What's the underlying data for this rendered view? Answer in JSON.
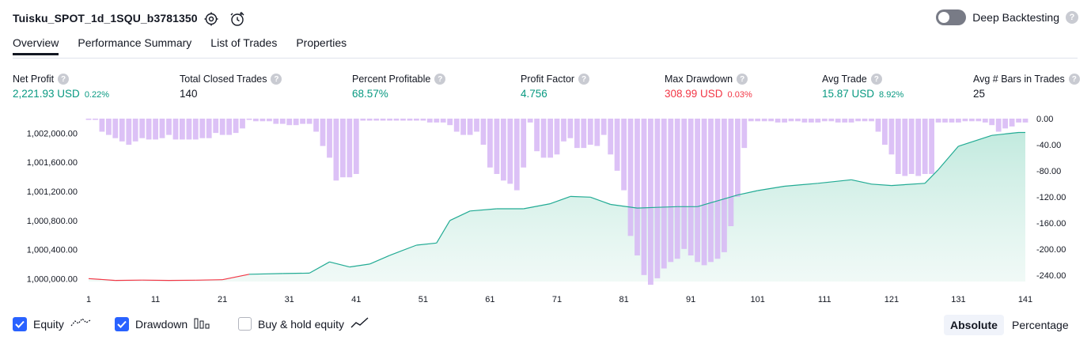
{
  "header": {
    "title": "Tuisku_SPOT_1d_1SQU_b3781350",
    "deep_backtesting_label": "Deep Backtesting",
    "help_glyph": "?"
  },
  "tabs": [
    {
      "label": "Overview"
    },
    {
      "label": "Performance Summary"
    },
    {
      "label": "List of Trades"
    },
    {
      "label": "Properties"
    }
  ],
  "metrics": {
    "net_profit": {
      "label": "Net Profit",
      "value": "2,221.93 USD",
      "pct": "0.22%"
    },
    "total_closed_trades": {
      "label": "Total Closed Trades",
      "value": "140"
    },
    "percent_profitable": {
      "label": "Percent Profitable",
      "value": "68.57%"
    },
    "profit_factor": {
      "label": "Profit Factor",
      "value": "4.756"
    },
    "max_drawdown": {
      "label": "Max Drawdown",
      "value": "308.99 USD",
      "pct": "0.03%"
    },
    "avg_trade": {
      "label": "Avg Trade",
      "value": "15.87 USD",
      "pct": "8.92%"
    },
    "avg_bars": {
      "label": "Avg # Bars in Trades",
      "value": "25"
    }
  },
  "legend": {
    "equity": "Equity",
    "drawdown": "Drawdown",
    "buy_hold": "Buy & hold equity",
    "absolute": "Absolute",
    "percentage": "Percentage"
  },
  "colors": {
    "green": "#089981",
    "red": "#f23645",
    "equity_line": "#22ab94",
    "equity_fill": "#cdeee6",
    "loss_line": "#f23645",
    "drawdown_bar": "#d6b6f5",
    "accent": "#2962ff"
  },
  "chart_data": {
    "type": "area",
    "x_ticks": [
      "1",
      "11",
      "21",
      "31",
      "41",
      "51",
      "61",
      "71",
      "81",
      "91",
      "101",
      "111",
      "121",
      "131",
      "141"
    ],
    "y_left_ticks": [
      "1,000,000.00",
      "1,000,400.00",
      "1,000,800.00",
      "1,001,200.00",
      "1,001,600.00",
      "1,002,000.00"
    ],
    "y_right_ticks": [
      "0.00",
      "-40.00",
      "-80.00",
      "-120.00",
      "-160.00",
      "-200.00",
      "-240.00"
    ],
    "x_range": [
      1,
      141
    ],
    "y_left_range": [
      999960,
      1002200
    ],
    "y_right_range": [
      -250,
      0
    ],
    "series": [
      {
        "name": "Equity",
        "type": "line",
        "x": [
          1,
          5,
          9,
          13,
          17,
          21,
          25,
          30,
          34,
          37,
          40,
          43,
          46,
          50,
          53,
          55,
          58,
          62,
          66,
          70,
          73,
          76,
          79,
          83,
          86,
          89,
          92,
          95,
          98,
          101,
          105,
          110,
          115,
          118,
          121,
          126,
          128,
          131,
          136,
          140,
          141
        ],
        "y": [
          1000000,
          999975,
          999980,
          999975,
          999978,
          999985,
          1000060,
          1000070,
          1000075,
          1000230,
          1000160,
          1000200,
          1000320,
          1000460,
          1000490,
          1000800,
          1000930,
          1000960,
          1000960,
          1001030,
          1001130,
          1001120,
          1001020,
          1000970,
          1000980,
          1000990,
          1000990,
          1001070,
          1001150,
          1001210,
          1001270,
          1001310,
          1001360,
          1001300,
          1001280,
          1001310,
          1001500,
          1001820,
          1001970,
          1002010,
          1002010
        ]
      },
      {
        "name": "Drawdown",
        "type": "bar",
        "x": [
          1,
          2,
          3,
          4,
          5,
          6,
          7,
          8,
          9,
          10,
          11,
          12,
          13,
          14,
          15,
          16,
          17,
          18,
          19,
          20,
          21,
          22,
          23,
          24,
          25,
          26,
          27,
          28,
          29,
          30,
          31,
          32,
          33,
          34,
          35,
          36,
          37,
          38,
          39,
          40,
          41,
          42,
          43,
          44,
          45,
          46,
          47,
          48,
          49,
          50,
          51,
          52,
          53,
          54,
          55,
          56,
          57,
          58,
          59,
          60,
          61,
          62,
          63,
          64,
          65,
          66,
          67,
          68,
          69,
          70,
          71,
          72,
          73,
          74,
          75,
          76,
          77,
          78,
          79,
          80,
          81,
          82,
          83,
          84,
          85,
          86,
          87,
          88,
          89,
          90,
          91,
          92,
          93,
          94,
          95,
          96,
          97,
          98,
          99,
          100,
          101,
          102,
          103,
          104,
          105,
          106,
          107,
          108,
          109,
          110,
          111,
          112,
          113,
          114,
          115,
          116,
          117,
          118,
          119,
          120,
          121,
          122,
          123,
          124,
          125,
          126,
          127,
          128,
          129,
          130,
          131,
          132,
          133,
          134,
          135,
          136,
          137,
          138,
          139,
          140,
          141
        ],
        "y": [
          -2,
          -2,
          -20,
          -25,
          -30,
          -35,
          -40,
          -35,
          -30,
          -32,
          -32,
          -30,
          -25,
          -32,
          -32,
          -32,
          -32,
          -30,
          -30,
          -22,
          -25,
          -25,
          -22,
          -15,
          -2,
          -4,
          -4,
          -4,
          -8,
          -8,
          -10,
          -10,
          -8,
          -8,
          -20,
          -42,
          -60,
          -95,
          -90,
          -90,
          -85,
          -3,
          -3,
          -3,
          -3,
          -3,
          -3,
          -3,
          -3,
          -3,
          -3,
          -6,
          -6,
          -6,
          -10,
          -20,
          -25,
          -25,
          -20,
          -40,
          -75,
          -85,
          -95,
          -100,
          -110,
          -75,
          -6,
          -50,
          -60,
          -60,
          -55,
          -35,
          -30,
          -45,
          -45,
          -40,
          -42,
          -25,
          -55,
          -80,
          -110,
          -180,
          -210,
          -240,
          -255,
          -245,
          -230,
          -220,
          -215,
          -200,
          -210,
          -220,
          -225,
          -220,
          -215,
          -205,
          -165,
          -120,
          -45,
          -4,
          -4,
          -4,
          -4,
          -6,
          -6,
          -4,
          -4,
          -6,
          -6,
          -6,
          -4,
          -4,
          -6,
          -6,
          -6,
          -4,
          -4,
          -4,
          -20,
          -40,
          -55,
          -85,
          -88,
          -85,
          -88,
          -85,
          -85,
          -6,
          -6,
          -6,
          -6,
          -4,
          -4,
          -4,
          -6,
          -10,
          -20,
          -15,
          -12,
          -6,
          -6
        ]
      }
    ]
  }
}
